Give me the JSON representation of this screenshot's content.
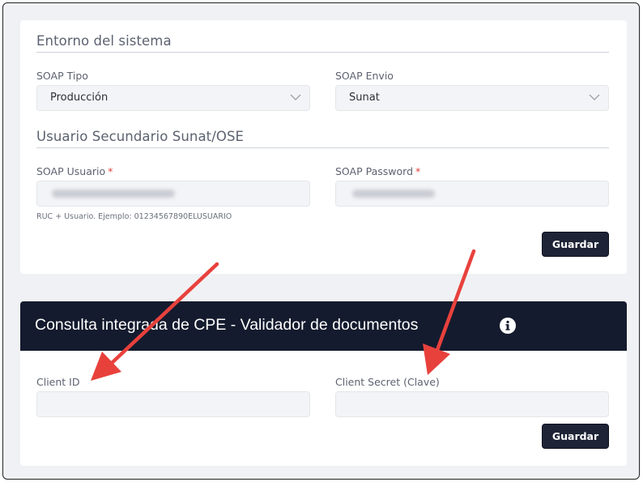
{
  "system_env": {
    "title": "Entorno del sistema",
    "soap_tipo": {
      "label": "SOAP Tipo",
      "value": "Producción"
    },
    "soap_envio": {
      "label": "SOAP Envio",
      "value": "Sunat"
    }
  },
  "secondary_user": {
    "title": "Usuario Secundario Sunat/OSE",
    "soap_usuario": {
      "label": "SOAP Usuario",
      "required_mark": "*",
      "hint": "RUC + Usuario. Ejemplo: 01234567890ELUSUARIO"
    },
    "soap_password": {
      "label": "SOAP Password",
      "required_mark": "*"
    },
    "save_label": "Guardar"
  },
  "cpe": {
    "title": "Consulta integrada de CPE - Validador de documentos",
    "info_icon": "info-circle-icon",
    "client_id": {
      "label": "Client ID",
      "value": ""
    },
    "client_secret": {
      "label": "Client Secret (Clave)",
      "value": ""
    },
    "save_label": "Guardar"
  },
  "colors": {
    "header_bg": "#141b2e",
    "button_bg": "#1e2436",
    "required": "#e0433b",
    "arrow": "#e8413c"
  }
}
